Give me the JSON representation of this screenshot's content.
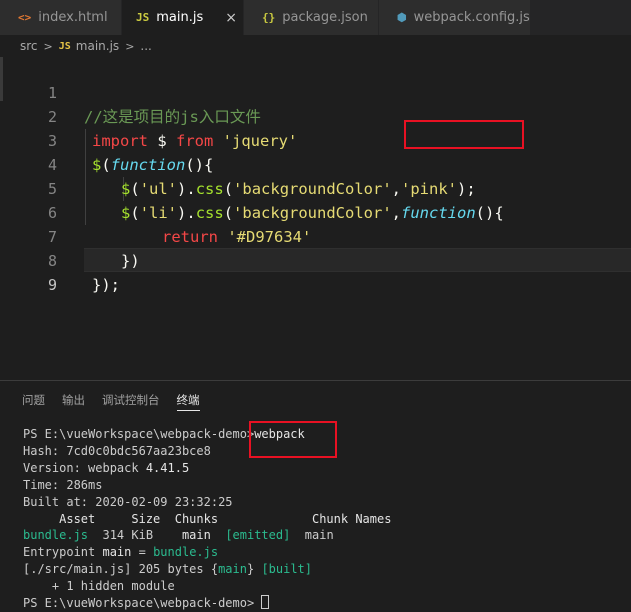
{
  "tabs": [
    {
      "icon": "<>",
      "label": "index.html",
      "icon_color": "#e37933",
      "active": false
    },
    {
      "icon": "JS",
      "label": "main.js",
      "icon_color": "#cbcb41",
      "active": true,
      "close": "×"
    },
    {
      "icon": "{}",
      "label": "package.json",
      "icon_color": "#cbcb41",
      "active": false
    },
    {
      "icon": "⬢",
      "label": "webpack.config.js",
      "icon_color": "#519aba",
      "active": false
    }
  ],
  "breadcrumb": {
    "folder": "src",
    "sep": ">",
    "file_icon": "JS",
    "file": "main.js",
    "more": "..."
  },
  "editor": {
    "line_numbers": [
      "1",
      "2",
      "3",
      "4",
      "5",
      "6",
      "7",
      "8",
      "9"
    ],
    "line1": {
      "comment": "//这是项目的js入口文件"
    },
    "line2": {
      "kw_import": "import",
      "dollar": " $ ",
      "kw_from": "from",
      "space": " ",
      "str": "'jquery'"
    },
    "line3": {
      "dollar": "$",
      "p1": "(",
      "kw_function": "function",
      "p2": "(){"
    },
    "line4": {
      "dollar": "$",
      "p1": "(",
      "s1": "'ul'",
      "p2": ").",
      "css": "css",
      "p3": "(",
      "s2": "'backgroundColor'",
      "p4": ",",
      "s3": "'pink'",
      "p5": ");"
    },
    "line5": {
      "dollar": "$",
      "p1": "(",
      "s1": "'li'",
      "p2": ").",
      "css": "css",
      "p3": "(",
      "s2": "'backgroundColor'",
      "p4": ",",
      "kw_function": "function",
      "p5": "(){"
    },
    "line6": {
      "kw_return": "return",
      "space": " ",
      "str": "'#D97634'"
    },
    "line7": {
      "p": "})"
    },
    "line8": {
      "p": "});"
    },
    "line9": {
      "p": ""
    }
  },
  "panel": {
    "tabs": [
      "问题",
      "输出",
      "调试控制台",
      "终端"
    ],
    "active_tab": "终端"
  },
  "terminal": {
    "prompt": "PS E:\\vueWorkspace\\webpack-demo>",
    "command": "webpack",
    "hash": "Hash: 7cd0c0bdc567aa23bce8",
    "version_label": "Version: webpack ",
    "version": "4.41.5",
    "time": "Time: 286ms",
    "built_at": "Built at: 2020-02-09 23:32:25",
    "table_header": "     Asset     Size  Chunks             Chunk Names",
    "asset_name": "bundle.js",
    "asset_size": "  314 KiB    ",
    "asset_chunk": "main",
    "asset_flag": "[emitted]",
    "asset_chunk_name": "main",
    "entrypoint_label": "Entrypoint ",
    "entrypoint_name": "main",
    "entrypoint_eq": " = ",
    "entrypoint_file": "bundle.js",
    "module_path": "[./src/main.js]",
    "module_size": " 205 bytes {",
    "module_chunk": "main",
    "module_close": "} ",
    "module_flag": "[built]",
    "hidden": "    + 1 hidden module",
    "final_prompt": "PS E:\\vueWorkspace\\webpack-demo> "
  },
  "colors": {
    "keyword": "#f44747",
    "string": "#e6db74",
    "function_call": "#a6e22e",
    "function_keyword": "#66d9ef",
    "comment": "#6a9955",
    "highlight_box": "#e81123",
    "terminal_green": "#2bbb8f",
    "terminal_cyan": "#11a8cd"
  }
}
